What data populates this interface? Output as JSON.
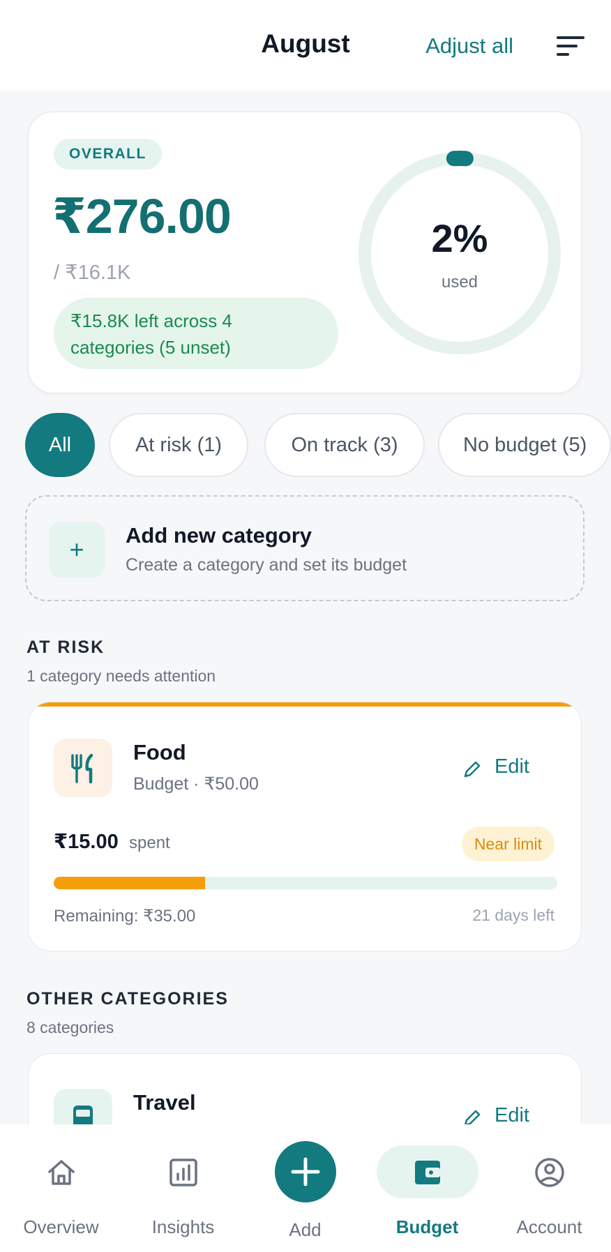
{
  "header": {
    "title": "August",
    "adjust_label": "Adjust all"
  },
  "overall": {
    "label": "OVERALL",
    "amount": "₹276.00",
    "total": "/ ₹16.1K",
    "left_line1": "₹15.8K left across 4",
    "left_line2": "categories (5 unset)",
    "percent_text": "2%",
    "used_label": "used",
    "used_fraction": 0.02
  },
  "chips": [
    "All",
    "At risk (1)",
    "On track (3)",
    "No budget (5)"
  ],
  "add_category": {
    "title": "Add new category",
    "subtitle": "Create a category and set its budget"
  },
  "at_risk": {
    "title": "AT RISK",
    "subtitle": "1 category needs attention",
    "card": {
      "name": "Food",
      "budget": "Budget · ₹50.00",
      "edit_label": "Edit",
      "spent_amount": "₹15.00",
      "spent_label": "spent",
      "badge": "Near limit",
      "progress_fraction": 0.3,
      "remaining": "Remaining: ₹35.00",
      "days_left": "21 days left"
    }
  },
  "other": {
    "title": "OTHER CATEGORIES",
    "subtitle": "8 categories",
    "card": {
      "name": "Travel",
      "edit_label": "Edit"
    }
  },
  "nav": {
    "overview": "Overview",
    "insights": "Insights",
    "add": "Add",
    "budget": "Budget",
    "account": "Account"
  },
  "colors": {
    "accent": "#137a7f",
    "warning": "#f59e0b",
    "success": "#1a8a4e"
  }
}
